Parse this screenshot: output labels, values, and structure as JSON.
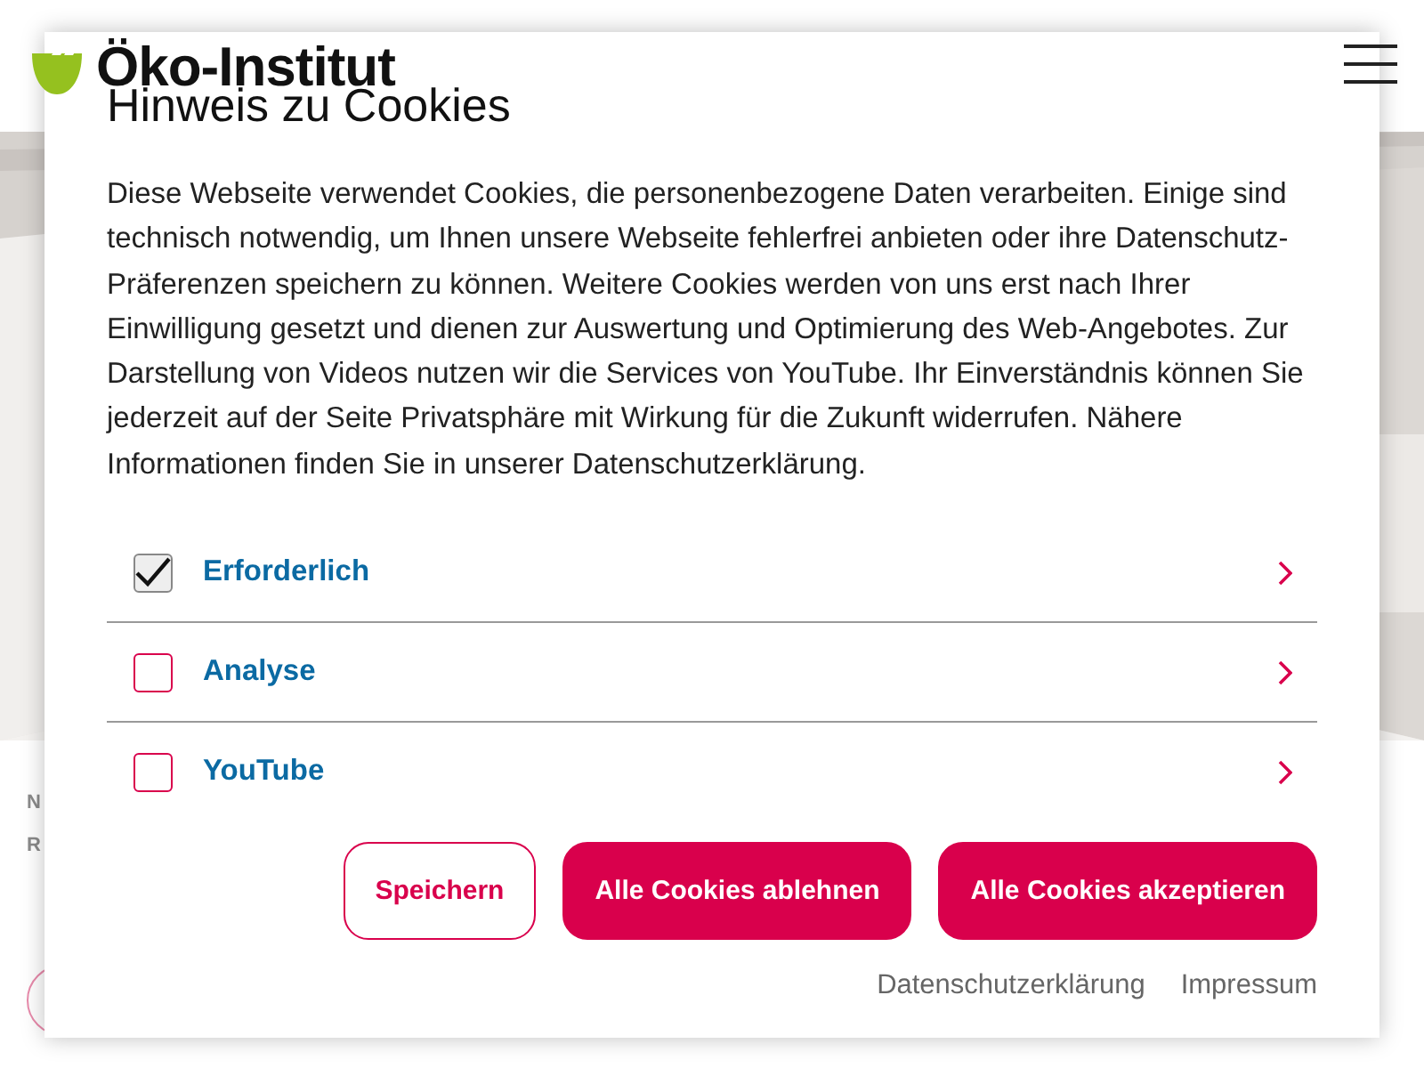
{
  "header": {
    "logo_text": "Öko-Institut"
  },
  "background": {
    "fragments": [
      "N",
      "R"
    ]
  },
  "cookie_dialog": {
    "title": "Hinweis zu Cookies",
    "text": "Diese Webseite verwendet Cookies, die personenbezogene Daten verarbeiten. Einige sind technisch notwendig, um Ihnen unsere Webseite fehlerfrei anbieten oder ihre Datenschutz-Präferenzen speichern zu können. Weitere Cookies werden von uns erst nach Ihrer Einwilligung gesetzt und dienen zur Auswertung und Optimierung des Web-Angebotes. Zur Darstellung von Videos nutzen wir die Services von YouTube. Ihr Einverständnis können Sie jederzeit auf der Seite Privatsphäre mit Wirkung für die Zukunft widerrufen. Nähere Informationen finden Sie in unserer Datenschutzerklärung.",
    "categories": [
      {
        "label": "Erforderlich",
        "checked": true,
        "disabled": true
      },
      {
        "label": "Analyse",
        "checked": false,
        "disabled": false
      },
      {
        "label": "YouTube",
        "checked": false,
        "disabled": false
      }
    ],
    "buttons": [
      {
        "label": "Speichern",
        "kind": "outline"
      },
      {
        "label": "Alle Cookies ablehnen",
        "kind": "filled"
      },
      {
        "label": "Alle Cookies akzeptieren",
        "kind": "filled"
      }
    ],
    "links": [
      "Datenschutzerklärung",
      "Impressum"
    ]
  }
}
